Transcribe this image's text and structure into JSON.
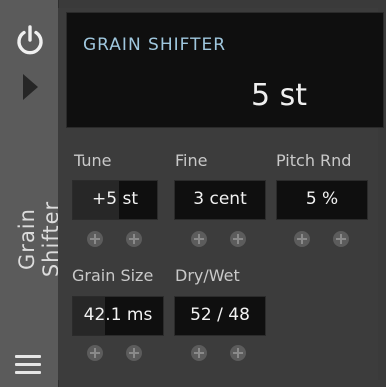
{
  "device": {
    "name": "Grain Shifter",
    "display": {
      "title": "GRAIN SHIFTER",
      "value": "5 st"
    },
    "params": [
      {
        "label": "Tune",
        "value": "+5 st"
      },
      {
        "label": "Fine",
        "value": "3 cent"
      },
      {
        "label": "Pitch Rnd",
        "value": "5 %"
      },
      {
        "label": "Grain Size",
        "value": "42.1 ms"
      },
      {
        "label": "Dry/Wet",
        "value": "52 / 48"
      }
    ]
  },
  "icons": {
    "power": "power-icon",
    "play": "play-icon",
    "menu": "hamburger-menu-icon",
    "modulation_add": "plus-icon"
  },
  "colors": {
    "accent": "#9fc7de"
  }
}
